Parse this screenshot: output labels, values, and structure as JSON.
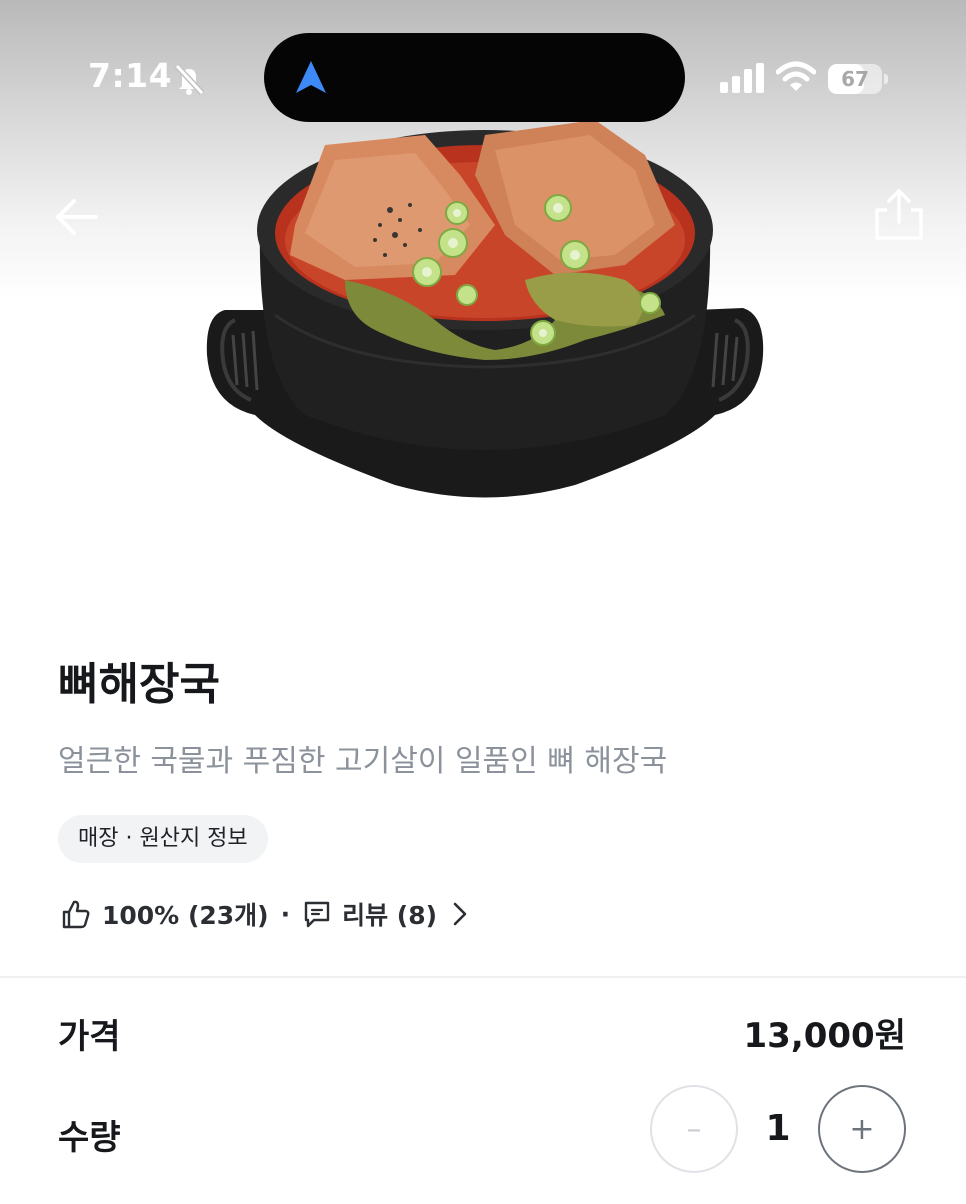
{
  "status_bar": {
    "time": "7:14",
    "battery": "67",
    "battery_level": 0.67
  },
  "product": {
    "name": "뼈해장국",
    "description": "얼큰한 국물과 푸짐한 고기살이 일품인 뼈 해장국",
    "info_chip": "매장 · 원산지 정보",
    "rating": "100% (23개)",
    "separator": "·",
    "review_link": "리뷰 (8)"
  },
  "order": {
    "price_label": "가격",
    "price_value": "13,000원",
    "quantity_label": "수량",
    "quantity_value": "1",
    "minus_label": "–",
    "plus_label": "+"
  },
  "icons": {
    "back": "arrow-left-icon",
    "share": "share-icon",
    "mute": "bell-slash-icon",
    "navigation": "location-arrow-icon",
    "signal": "cellular-signal-icon",
    "wifi": "wifi-icon",
    "rating": "thumbs-up-icon",
    "review": "comment-icon",
    "chevron": "chevron-right-icon"
  },
  "colors": {
    "navigation_arrow": "#3d8af7",
    "description_text": "#8b929b",
    "chip_background": "#f2f3f5"
  }
}
